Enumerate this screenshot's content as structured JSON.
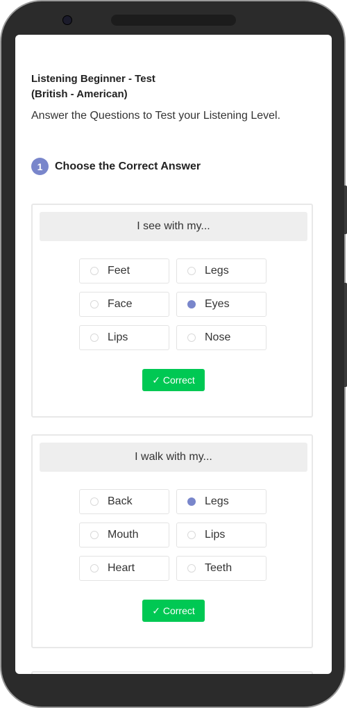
{
  "header": {
    "title_line1": "Listening Beginner - Test",
    "title_line2": "(British - American)",
    "subtitle": "Answer the Questions to Test your Listening Level."
  },
  "section": {
    "number": "1",
    "title": "Choose the Correct Answer"
  },
  "questions": [
    {
      "prompt": "I see with my...",
      "options": [
        {
          "label": "Feet",
          "selected": false
        },
        {
          "label": "Legs",
          "selected": false
        },
        {
          "label": "Face",
          "selected": false
        },
        {
          "label": "Eyes",
          "selected": true
        },
        {
          "label": "Lips",
          "selected": false
        },
        {
          "label": "Nose",
          "selected": false
        }
      ],
      "result": "✓ Correct"
    },
    {
      "prompt": "I walk with my...",
      "options": [
        {
          "label": "Back",
          "selected": false
        },
        {
          "label": "Legs",
          "selected": true
        },
        {
          "label": "Mouth",
          "selected": false
        },
        {
          "label": "Lips",
          "selected": false
        },
        {
          "label": "Heart",
          "selected": false
        },
        {
          "label": "Teeth",
          "selected": false
        }
      ],
      "result": "✓ Correct"
    }
  ],
  "colors": {
    "accent": "#7986cb",
    "correct": "#00c853",
    "prompt_bg": "#eeeeee",
    "frame": "#2b2b2b"
  }
}
